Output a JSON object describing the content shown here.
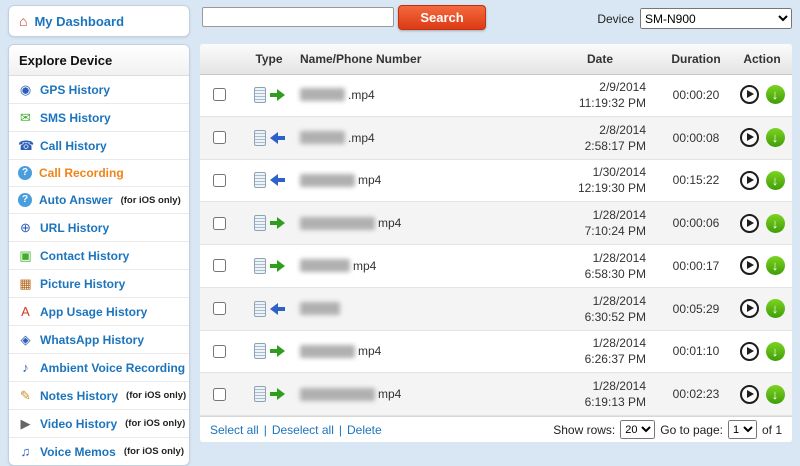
{
  "icons": {
    "home_glyph": "⌂",
    "download_glyph": "↓"
  },
  "topbar": {
    "search_value": "",
    "search_button": "Search",
    "device_label": "Device",
    "device_value": "SM-N900"
  },
  "sidebar": {
    "dashboard": "My Dashboard",
    "section_title": "Explore Device",
    "items": [
      {
        "label": "GPS History",
        "note": "",
        "glyph": "◉",
        "color": "#2e5fb8"
      },
      {
        "label": "SMS History",
        "note": "",
        "glyph": "✉",
        "color": "#3fae2a"
      },
      {
        "label": "Call History",
        "note": "",
        "glyph": "☎",
        "color": "#2e5fb8"
      },
      {
        "label": "Call Recording",
        "note": "",
        "glyph": "?",
        "color": "#ffffff",
        "bg": "#4a9ede",
        "active": true
      },
      {
        "label": "Auto Answer",
        "note": "(for iOS only)",
        "glyph": "?",
        "color": "#ffffff",
        "bg": "#4a9ede"
      },
      {
        "label": "URL History",
        "note": "",
        "glyph": "⊕",
        "color": "#2e5fb8"
      },
      {
        "label": "Contact History",
        "note": "",
        "glyph": "▣",
        "color": "#3fae2a"
      },
      {
        "label": "Picture History",
        "note": "",
        "glyph": "▦",
        "color": "#b5651d"
      },
      {
        "label": "App Usage History",
        "note": "",
        "glyph": "A",
        "color": "#d43a1f"
      },
      {
        "label": "WhatsApp History",
        "note": "",
        "glyph": "◈",
        "color": "#2e5fb8"
      },
      {
        "label": "Ambient Voice Recording",
        "note": "",
        "glyph": "♪",
        "color": "#2e5fb8"
      },
      {
        "label": "Notes History",
        "note": "(for iOS only)",
        "glyph": "✎",
        "color": "#c78f2d"
      },
      {
        "label": "Video History",
        "note": "(for iOS only)",
        "glyph": "▶",
        "color": "#666666"
      },
      {
        "label": "Voice Memos",
        "note": "(for iOS only)",
        "glyph": "♫",
        "color": "#2e5fb8"
      }
    ]
  },
  "table": {
    "headers": [
      "Type",
      "Name/Phone Number",
      "Date",
      "Duration",
      "Action"
    ],
    "rows": [
      {
        "direction": "outgoing",
        "redacted_width": 45,
        "name": ".mp4",
        "date": "2/9/2014",
        "time": "11:19:32 PM",
        "duration": "00:00:20"
      },
      {
        "direction": "incoming",
        "redacted_width": 45,
        "name": ".mp4",
        "date": "2/8/2014",
        "time": "2:58:17 PM",
        "duration": "00:00:08"
      },
      {
        "direction": "incoming",
        "redacted_width": 55,
        "name": "mp4",
        "date": "1/30/2014",
        "time": "12:19:30 PM",
        "duration": "00:15:22"
      },
      {
        "direction": "outgoing",
        "redacted_width": 75,
        "name": "mp4",
        "date": "1/28/2014",
        "time": "7:10:24 PM",
        "duration": "00:00:06"
      },
      {
        "direction": "outgoing",
        "redacted_width": 50,
        "name": "mp4",
        "date": "1/28/2014",
        "time": "6:58:30 PM",
        "duration": "00:00:17"
      },
      {
        "direction": "incoming",
        "redacted_width": 40,
        "name": "",
        "date": "1/28/2014",
        "time": "6:30:52 PM",
        "duration": "00:05:29"
      },
      {
        "direction": "outgoing",
        "redacted_width": 55,
        "name": "mp4",
        "date": "1/28/2014",
        "time": "6:26:37 PM",
        "duration": "00:01:10"
      },
      {
        "direction": "outgoing",
        "redacted_width": 75,
        "name": "mp4",
        "date": "1/28/2014",
        "time": "6:19:13 PM",
        "duration": "00:02:23"
      }
    ]
  },
  "footer": {
    "select_all": "Select all",
    "deselect_all": "Deselect all",
    "delete": "Delete",
    "sep": "|",
    "show_rows_label": "Show rows:",
    "show_rows_value": "20",
    "go_to_page_label": "Go to page:",
    "page_value": "1",
    "of_label": "of 1"
  }
}
